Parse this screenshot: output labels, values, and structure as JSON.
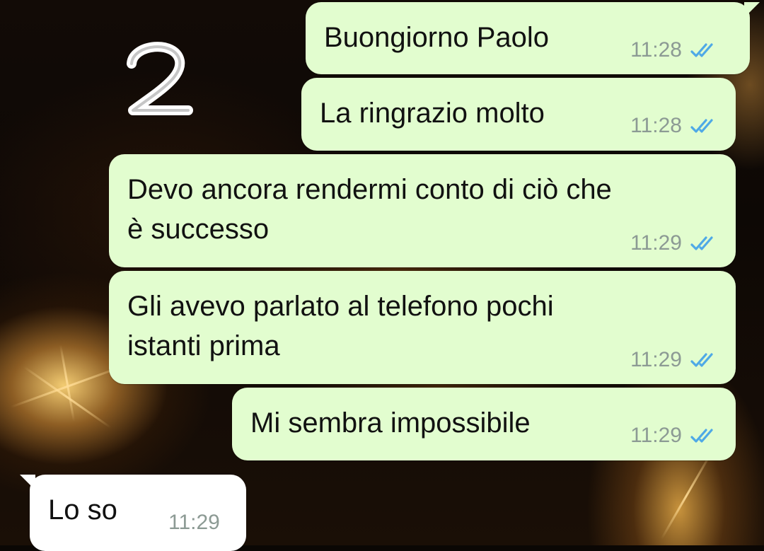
{
  "sticker": {
    "label": "2"
  },
  "messages": [
    {
      "direction": "outgoing",
      "lines": [
        "Buongiorno Paolo"
      ],
      "time": "11:28",
      "status_icon": "double-check-blue-icon"
    },
    {
      "direction": "outgoing",
      "lines": [
        "La ringrazio molto"
      ],
      "time": "11:28",
      "status_icon": "double-check-blue-icon"
    },
    {
      "direction": "outgoing",
      "lines": [
        "Devo ancora rendermi conto di ciò che",
        "è successo"
      ],
      "time": "11:29",
      "status_icon": "double-check-blue-icon"
    },
    {
      "direction": "outgoing",
      "lines": [
        "Gli avevo parlato al telefono pochi",
        "istanti prima"
      ],
      "time": "11:29",
      "status_icon": "double-check-blue-icon"
    },
    {
      "direction": "outgoing",
      "lines": [
        "Mi sembra impossibile"
      ],
      "time": "11:29",
      "status_icon": "double-check-blue-icon"
    },
    {
      "direction": "incoming",
      "lines": [
        "Lo so"
      ],
      "time": "11:29"
    }
  ],
  "colors": {
    "outgoing_bubble": "#e2fdcf",
    "incoming_bubble": "#ffffff",
    "read_ticks": "#4fa9e6",
    "timestamp": "#8c9a94"
  }
}
